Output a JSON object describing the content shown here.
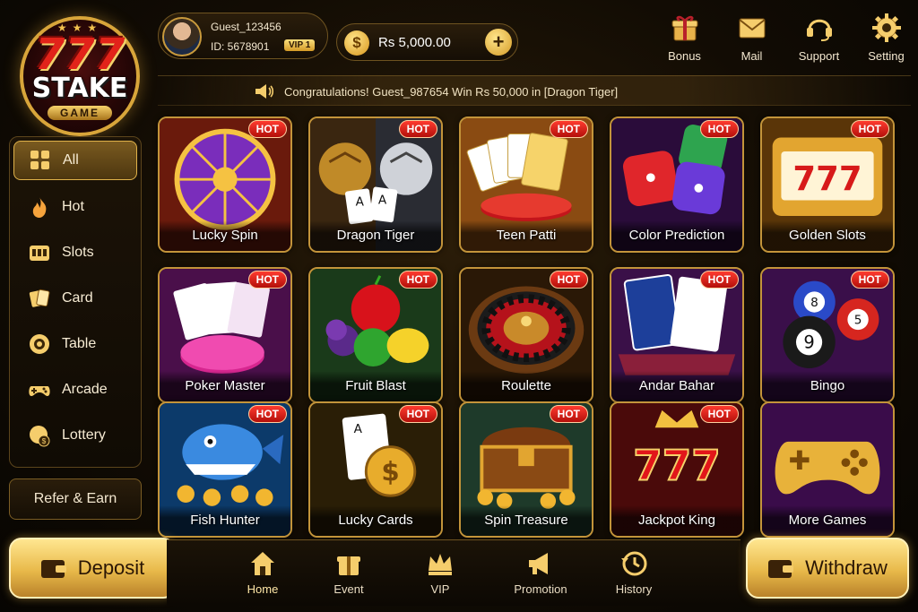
{
  "logo": {
    "top_text": "777",
    "brand": "STAKE",
    "sub": "GAME"
  },
  "profile": {
    "name": "Guest_123456",
    "id": "ID: 5678901",
    "vip": "VIP 1"
  },
  "balance": {
    "amount": "Rs 5,000.00",
    "plus": "+"
  },
  "top_nav": [
    {
      "label": "Bonus",
      "icon": "gift-icon"
    },
    {
      "label": "Mail",
      "icon": "mail-icon"
    },
    {
      "label": "Support",
      "icon": "headset-icon"
    },
    {
      "label": "Setting",
      "icon": "gear-icon"
    }
  ],
  "marquee": {
    "text": "Congratulations! Guest_987654 Win Rs 50,000 in [Dragon Tiger]"
  },
  "sidebar": {
    "categories": [
      {
        "label": "All",
        "icon": "grid-icon",
        "active": true
      },
      {
        "label": "Hot",
        "icon": "flame-icon"
      },
      {
        "label": "Slots",
        "icon": "slot-machine-icon"
      },
      {
        "label": "Card",
        "icon": "cards-icon"
      },
      {
        "label": "Table",
        "icon": "chip-icon"
      },
      {
        "label": "Arcade",
        "icon": "gamepad-icon"
      },
      {
        "label": "Lottery",
        "icon": "lottery-ball-icon"
      }
    ],
    "refer_label": "Refer & Earn"
  },
  "games": [
    {
      "name": "Lucky Spin",
      "hot": "HOT"
    },
    {
      "name": "Dragon Tiger",
      "hot": "HOT"
    },
    {
      "name": "Teen Patti",
      "hot": "HOT"
    },
    {
      "name": "Color Prediction",
      "hot": "HOT"
    },
    {
      "name": "Golden Slots",
      "hot": "HOT"
    },
    {
      "name": "Poker Master",
      "hot": "HOT"
    },
    {
      "name": "Fruit Blast",
      "hot": "HOT"
    },
    {
      "name": "Roulette",
      "hot": "HOT"
    },
    {
      "name": "Andar Bahar",
      "hot": "HOT"
    },
    {
      "name": "Bingo",
      "hot": "HOT"
    },
    {
      "name": "Fish Hunter",
      "hot": "HOT"
    },
    {
      "name": "Lucky Cards",
      "hot": "HOT"
    },
    {
      "name": "Spin Treasure",
      "hot": "HOT"
    },
    {
      "name": "Jackpot King",
      "hot": "HOT"
    },
    {
      "name": "More Games",
      "hot": ""
    }
  ],
  "game_art": {
    "bingo_balls": [
      "8",
      "9",
      "5"
    ],
    "golden_slots_reels": "777",
    "jackpot_number": "777",
    "card_letter": "A",
    "coin_symbol": "$"
  },
  "bottom_nav": [
    {
      "label": "Home",
      "icon": "home-icon",
      "active": true
    },
    {
      "label": "Event",
      "icon": "gift-icon"
    },
    {
      "label": "VIP",
      "icon": "crown-icon"
    },
    {
      "label": "Promotion",
      "icon": "megaphone-icon"
    },
    {
      "label": "History",
      "icon": "history-icon"
    }
  ],
  "actions": {
    "deposit": "Deposit",
    "withdraw": "Withdraw"
  },
  "colors": {
    "accent_gold": "#e0b24a",
    "hot_red": "#e0231a",
    "background": "#120c04"
  }
}
